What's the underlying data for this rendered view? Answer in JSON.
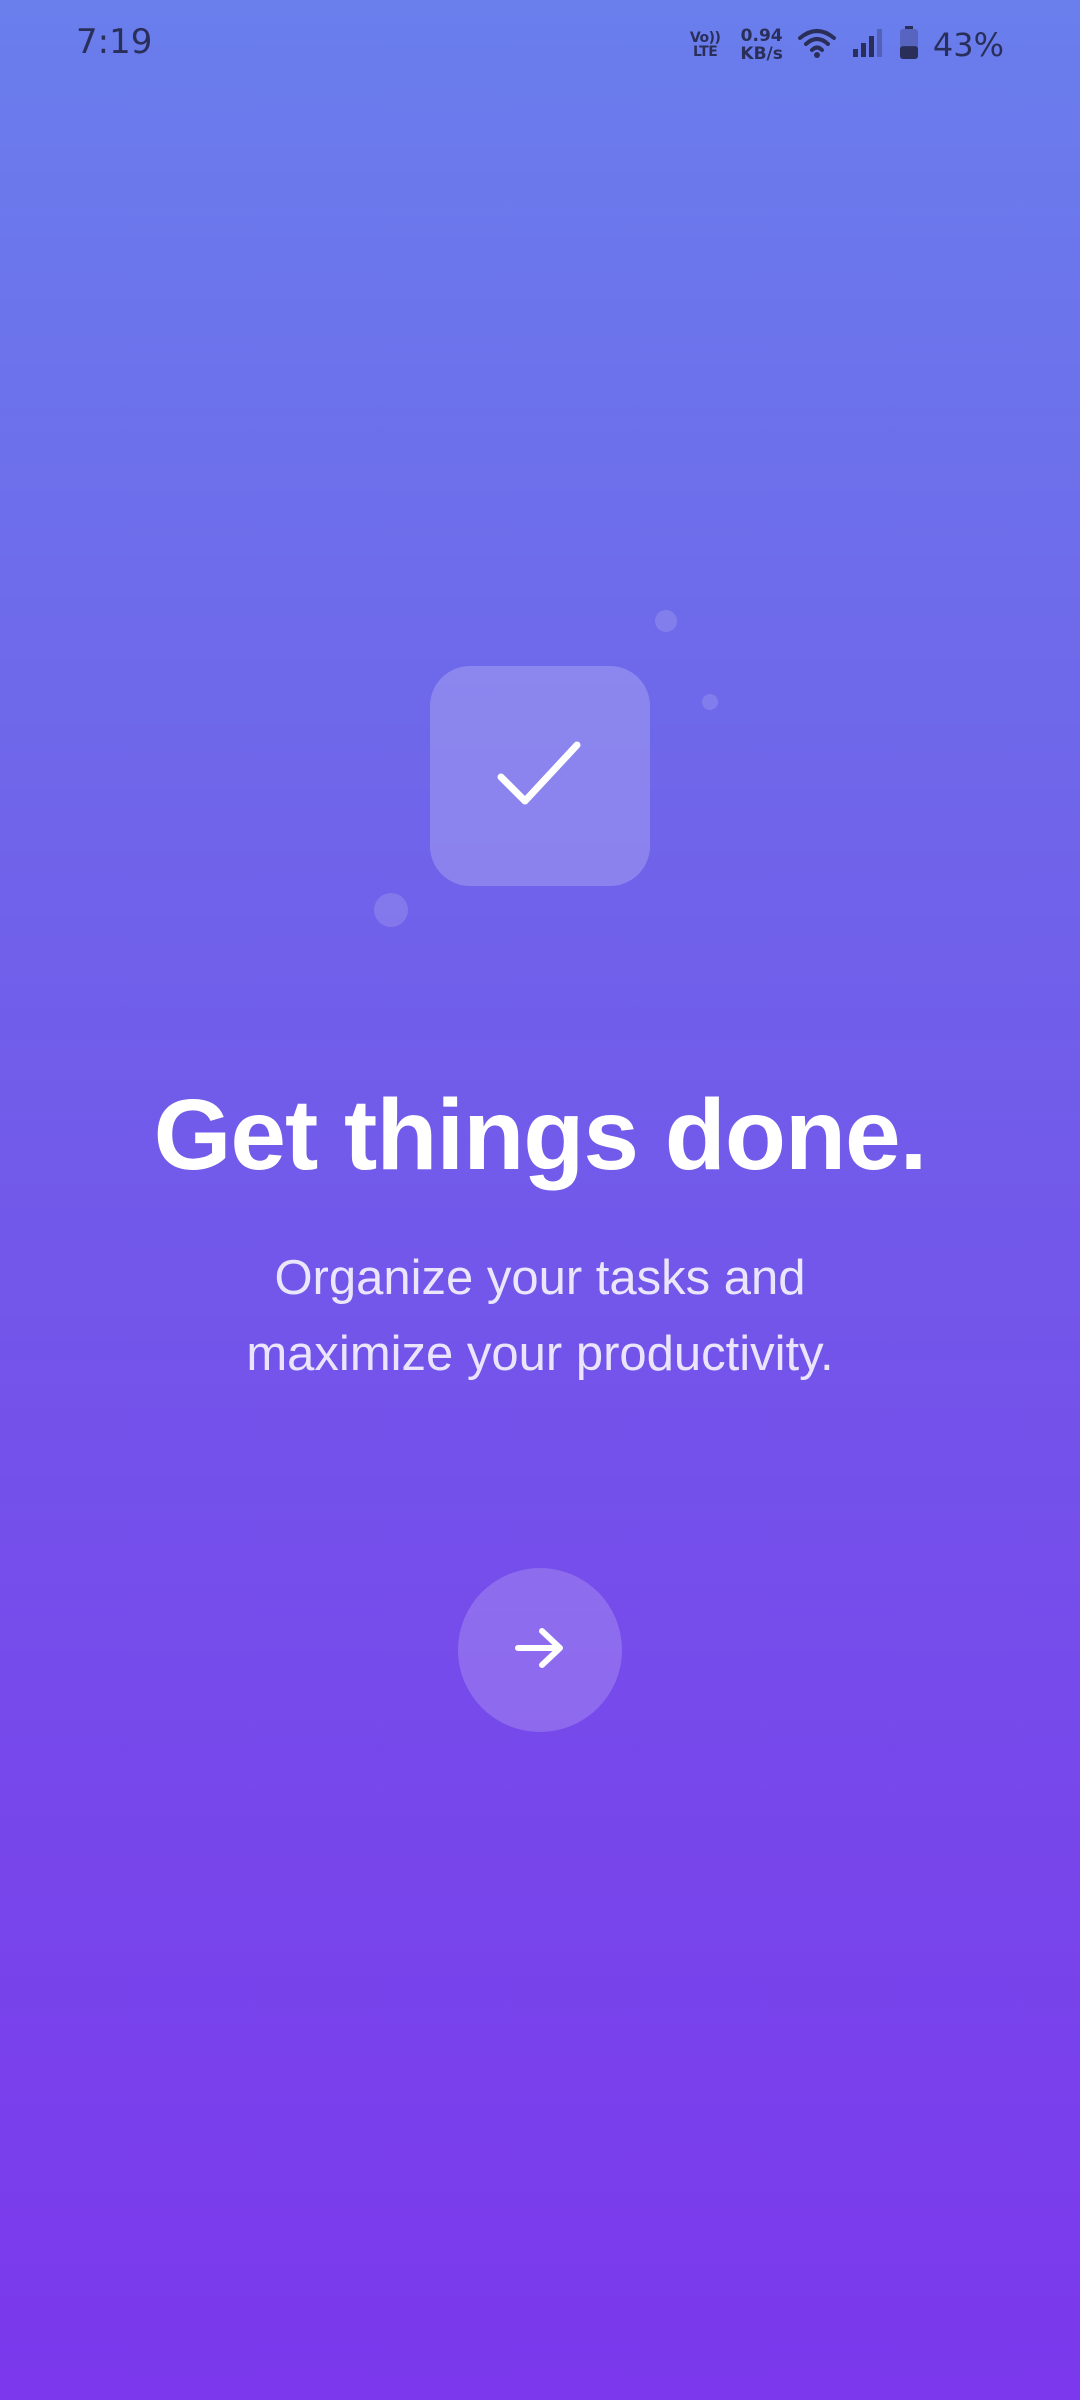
{
  "status_bar": {
    "time": "7:19",
    "volte_top": "Vo))",
    "volte_bottom": "LTE",
    "net_speed_value": "0.94",
    "net_speed_unit": "KB/s",
    "battery_percent": "43%",
    "battery_level": 0.43,
    "icons": [
      "volte-icon",
      "wifi-icon",
      "signal-icon",
      "battery-icon"
    ]
  },
  "onboarding": {
    "hero_icon": "checkmark-icon",
    "headline": "Get things done.",
    "subtitle_line1": "Organize your tasks and",
    "subtitle_line2": "maximize your productivity.",
    "next_button_icon": "arrow-right-icon"
  },
  "colors": {
    "gradient_top": "#6a7eec",
    "gradient_bottom": "#7b38ec",
    "text_primary": "#ffffff",
    "status_text": "#2a2f5a"
  }
}
